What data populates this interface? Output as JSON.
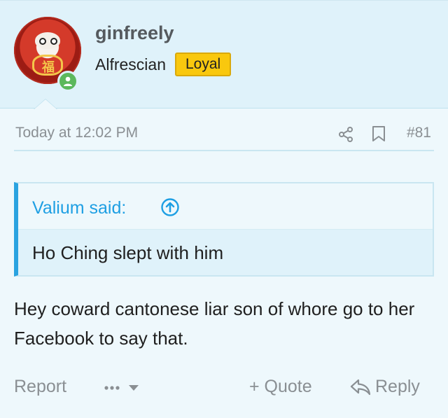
{
  "post": {
    "username": "ginfreely",
    "user_title": "Alfrescian",
    "badge": "Loyal",
    "timestamp": "Today at 12:02 PM",
    "post_number": "#81",
    "quote": {
      "attribution": "Valium said:",
      "text": "Ho Ching slept with him"
    },
    "message": "Hey coward cantonese liar son of whore go to her Facebook to say that."
  },
  "actions": {
    "report": "Report",
    "more": "•••",
    "quote": "+ Quote",
    "reply": "Reply"
  },
  "colors": {
    "accent": "#1e9fe3",
    "badge": "#f9c80e",
    "online": "#5cb85c",
    "header_bg": "#dff2fa"
  },
  "icons": [
    "share-icon",
    "bookmark-icon",
    "arrow-up-circle-icon",
    "online-status-icon",
    "chevron-down-icon",
    "reply-icon"
  ]
}
